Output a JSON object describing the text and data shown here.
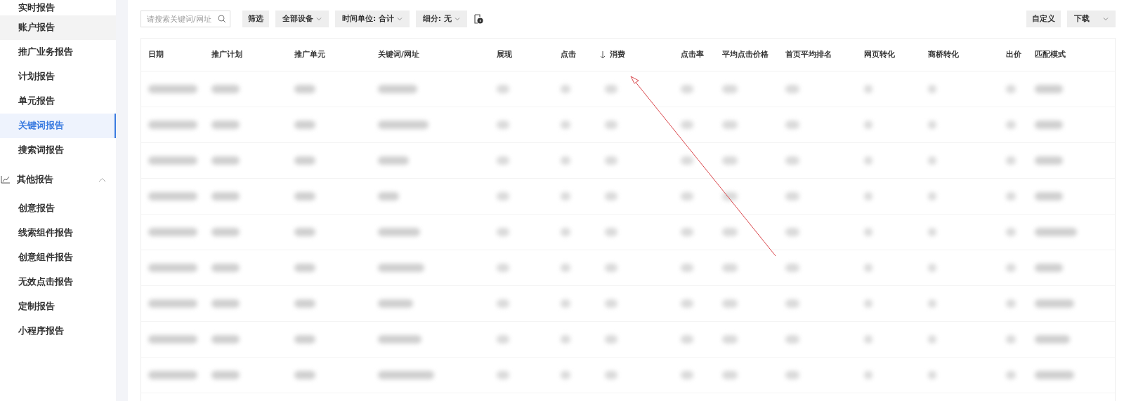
{
  "sidebar": {
    "items": [
      {
        "label": "实时报告",
        "selected": false,
        "hovered": false
      },
      {
        "label": "账户报告",
        "selected": false,
        "hovered": true
      },
      {
        "label": "推广业务报告",
        "selected": false,
        "hovered": false
      },
      {
        "label": "计划报告",
        "selected": false,
        "hovered": false
      },
      {
        "label": "单元报告",
        "selected": false,
        "hovered": false
      },
      {
        "label": "关键词报告",
        "selected": true,
        "hovered": false
      },
      {
        "label": "搜索词报告",
        "selected": false,
        "hovered": false
      }
    ],
    "group": {
      "label": "其他报告",
      "expanded": true,
      "children": [
        {
          "label": "创意报告",
          "selected": false,
          "hovered": false
        },
        {
          "label": "线索组件报告",
          "selected": false,
          "hovered": false
        },
        {
          "label": "创意组件报告",
          "selected": false,
          "hovered": false
        },
        {
          "label": "无效点击报告",
          "selected": false,
          "hovered": false
        },
        {
          "label": "定制报告",
          "selected": false,
          "hovered": false
        },
        {
          "label": "小程序报告",
          "selected": false,
          "hovered": false
        }
      ]
    }
  },
  "toolbar": {
    "search": {
      "placeholder": "请搜索关键词/网址"
    },
    "filters": [
      {
        "label": "筛选",
        "kind": "button"
      },
      {
        "label": "全部设备",
        "kind": "dropdown"
      },
      {
        "label": "时间单位: 合计",
        "kind": "dropdown"
      },
      {
        "label": "细分: 无",
        "kind": "dropdown"
      }
    ],
    "right": [
      {
        "label": "自定义",
        "kind": "button"
      },
      {
        "label": "下载",
        "kind": "dropdown"
      }
    ]
  },
  "table": {
    "columns": [
      {
        "label": "日期",
        "sorted": false
      },
      {
        "label": "推广计划",
        "sorted": false
      },
      {
        "label": "推广单元",
        "sorted": false
      },
      {
        "label": "关键词/网址",
        "sorted": false
      },
      {
        "label": "展现",
        "sorted": false
      },
      {
        "label": "点击",
        "sorted": false
      },
      {
        "label": "消费",
        "sorted": true
      },
      {
        "label": "点击率",
        "sorted": false
      },
      {
        "label": "平均点击价格",
        "sorted": false
      },
      {
        "label": "首页平均排名",
        "sorted": false
      },
      {
        "label": "网页转化",
        "sorted": false
      },
      {
        "label": "商桥转化",
        "sorted": false
      },
      {
        "label": "出价",
        "sorted": false
      },
      {
        "label": "匹配模式",
        "sorted": false
      }
    ]
  }
}
